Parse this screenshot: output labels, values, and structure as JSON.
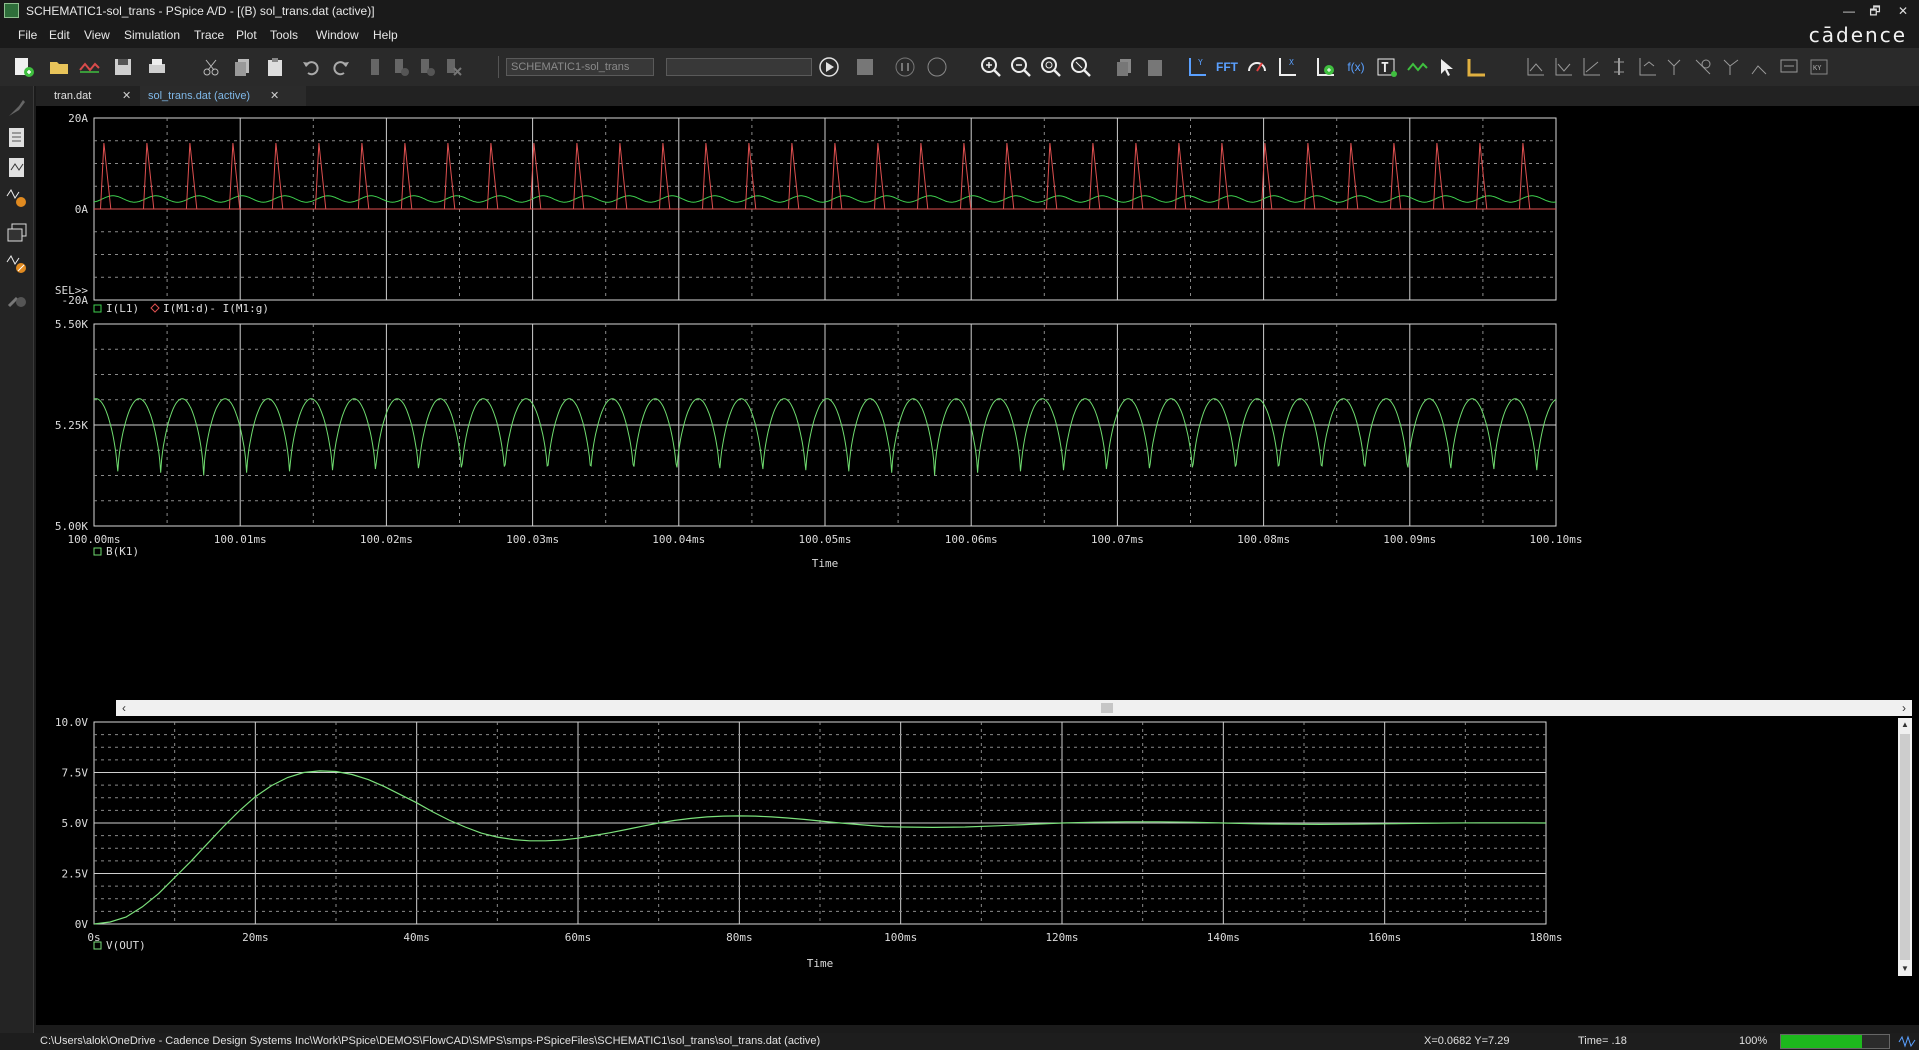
{
  "window": {
    "title": "SCHEMATIC1-sol_trans - PSpice A/D - [(B) sol_trans.dat (active)]",
    "minimize": "—",
    "restore": "🗗",
    "close": "✕"
  },
  "menu": [
    "File",
    "Edit",
    "View",
    "Simulation",
    "Trace",
    "Plot",
    "Tools",
    "Window",
    "Help"
  ],
  "brand": "cādence",
  "toolbar": {
    "profile_combo": "SCHEMATIC1-sol_trans",
    "status_combo": "",
    "fft_label": "FFT",
    "fx_label": "f(x)"
  },
  "tabs": [
    {
      "label": "tran.dat",
      "active": false
    },
    {
      "label": "sol_trans.dat (active)",
      "active": true
    }
  ],
  "plots": {
    "currents": {
      "ylabels": [
        "20A",
        "0A",
        "-20A"
      ],
      "sel_label": "SEL>>",
      "legend": [
        {
          "label": "I(L1)",
          "color": "#3fd04f",
          "marker": "square"
        },
        {
          "label": "I(M1:d)- I(M1:g)",
          "color": "#e05050",
          "marker": "diamond"
        }
      ]
    },
    "flux": {
      "ylabels": [
        "5.50K",
        "5.25K",
        "5.00K"
      ],
      "legend": [
        {
          "label": "B(K1)",
          "color": "#6fdc6f",
          "marker": "square"
        }
      ],
      "xlabels": [
        "100.00ms",
        "100.01ms",
        "100.02ms",
        "100.03ms",
        "100.04ms",
        "100.05ms",
        "100.06ms",
        "100.07ms",
        "100.08ms",
        "100.09ms",
        "100.10ms"
      ],
      "xtitle": "Time"
    },
    "vout": {
      "ylabels": [
        "10.0V",
        "7.5V",
        "5.0V",
        "2.5V",
        "0V"
      ],
      "xlabels": [
        "0s",
        "20ms",
        "40ms",
        "60ms",
        "80ms",
        "100ms",
        "120ms",
        "140ms",
        "160ms",
        "180ms"
      ],
      "xtitle": "Time",
      "legend": [
        {
          "label": "V(OUT)",
          "color": "#7be07b",
          "marker": "square"
        }
      ]
    }
  },
  "chart_data": [
    {
      "type": "line",
      "title": "",
      "xlim": [
        100.0,
        100.1
      ],
      "ylim": [
        -20,
        20
      ],
      "yticks": [
        "20A",
        "0A",
        "-20A"
      ],
      "series": [
        {
          "name": "I(L1)",
          "color": "#3fd04f",
          "description_values": {
            "baseline_A": 2.2,
            "ripple_pk_A": 3.1,
            "periods": 34
          }
        },
        {
          "name": "I(M1:d)- I(M1:g)",
          "color": "#e05050",
          "description_values": {
            "peak_A": 14.5,
            "off_A": 0,
            "periods": 34
          }
        }
      ]
    },
    {
      "type": "line",
      "xlim": [
        100.0,
        100.1
      ],
      "ylim": [
        5000,
        5500
      ],
      "yticks": [
        "5.50K",
        "5.25K",
        "5.00K"
      ],
      "xlabel": "Time",
      "series": [
        {
          "name": "B(K1)",
          "color": "#6fdc6f",
          "description_values": {
            "max": 5315,
            "min": 5125,
            "periods": 34
          }
        }
      ]
    },
    {
      "type": "line",
      "xlim": [
        0,
        180
      ],
      "ylim": [
        0,
        10
      ],
      "xlabel": "Time",
      "x_unit": "ms",
      "series": [
        {
          "name": "V(OUT)",
          "color": "#7be07b",
          "x": [
            0,
            2,
            4,
            6,
            8,
            10,
            12,
            14,
            16,
            18,
            20,
            22,
            24,
            26,
            28,
            30,
            32,
            34,
            36,
            38,
            40,
            42,
            44,
            46,
            48,
            50,
            52,
            54,
            56,
            58,
            60,
            62,
            64,
            66,
            68,
            70,
            72,
            74,
            76,
            78,
            80,
            82,
            84,
            86,
            88,
            90,
            92,
            94,
            96,
            98,
            100,
            104,
            108,
            112,
            116,
            120,
            124,
            128,
            132,
            136,
            140,
            144,
            148,
            152,
            156,
            160,
            164,
            168,
            172,
            176,
            180
          ],
          "y": [
            0.0,
            0.1,
            0.35,
            0.85,
            1.5,
            2.3,
            3.1,
            3.95,
            4.8,
            5.6,
            6.3,
            6.85,
            7.25,
            7.5,
            7.58,
            7.55,
            7.4,
            7.15,
            6.8,
            6.4,
            6.0,
            5.55,
            5.15,
            4.8,
            4.5,
            4.3,
            4.18,
            4.12,
            4.12,
            4.16,
            4.25,
            4.38,
            4.52,
            4.68,
            4.84,
            5.0,
            5.13,
            5.23,
            5.3,
            5.34,
            5.35,
            5.34,
            5.3,
            5.25,
            5.18,
            5.1,
            5.02,
            4.95,
            4.88,
            4.82,
            4.8,
            4.78,
            4.8,
            4.86,
            4.93,
            5.0,
            5.04,
            5.06,
            5.06,
            5.04,
            5.0,
            4.96,
            4.94,
            4.93,
            4.94,
            4.96,
            4.98,
            5.0,
            5.01,
            5.01,
            5.0
          ]
        }
      ]
    }
  ],
  "status": {
    "path": "C:\\Users\\alok\\OneDrive - Cadence Design Systems Inc\\Work\\PSpice\\DEMOS\\FlowCAD\\SMPS\\smps-PSpiceFiles\\SCHEMATIC1\\sol_trans\\sol_trans.dat (active)",
    "xy": "X=0.0682  Y=7.29",
    "time": "Time= .18",
    "zoom": "100%",
    "progress_fraction": 0.75
  }
}
